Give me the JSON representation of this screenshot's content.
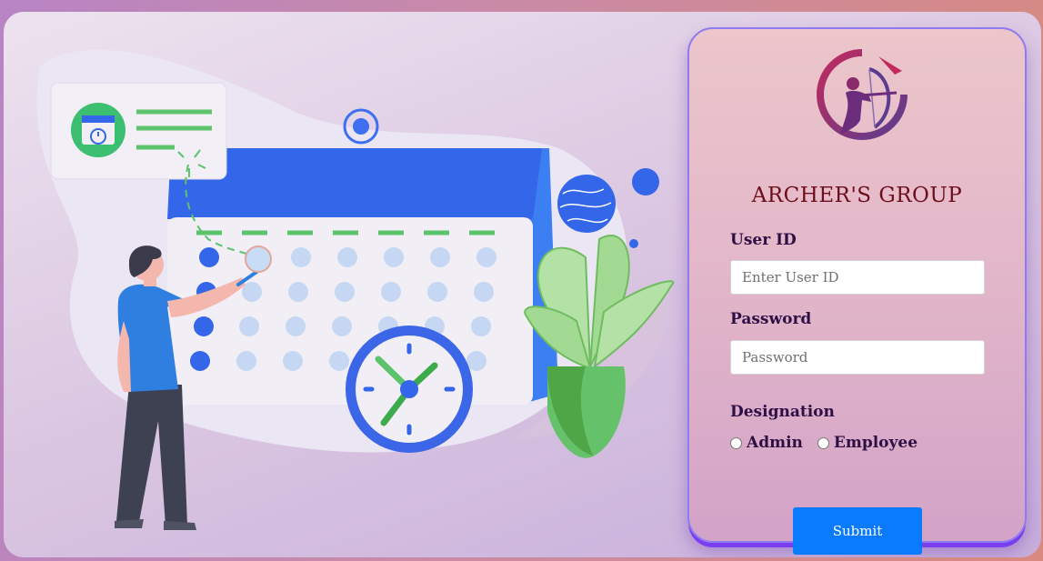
{
  "brand": {
    "name": "ARCHER'S GROUP",
    "logo_icon": "archer-logo-icon"
  },
  "form": {
    "user_id_label": "User ID",
    "user_id_placeholder": "Enter User ID",
    "user_id_value": "",
    "password_label": "Password",
    "password_placeholder": "Password",
    "password_value": "",
    "designation_label": "Designation",
    "designation_options": [
      "Admin",
      "Employee"
    ],
    "submit_label": "Submit"
  },
  "colors": {
    "brand_text": "#6e0d1a",
    "label_text": "#2e0f45",
    "submit_bg": "#0a7bff",
    "panel_border": "#8f7bf0",
    "calendar_blue": "#3d6ff0",
    "accent_green": "#5cc26b"
  },
  "illustration": {
    "icons": [
      "calendar-icon",
      "clock-icon",
      "plant-icon",
      "person-icon",
      "globe-icon",
      "target-icon"
    ]
  }
}
